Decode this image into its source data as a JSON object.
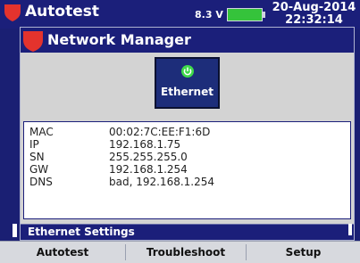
{
  "status_bar": {
    "app_title": "Autotest",
    "voltage": "8.3 V",
    "date": "20-Aug-2014",
    "time": "22:32:14",
    "battery_level_percent": 100
  },
  "window": {
    "title": "Network Manager",
    "tile": {
      "label": "Ethernet",
      "icon": "power-icon"
    },
    "info": [
      {
        "key": "MAC",
        "value": "00:02:7C:EE:F1:6D"
      },
      {
        "key": "IP",
        "value": "192.168.1.75"
      },
      {
        "key": "SN",
        "value": "255.255.255.0"
      },
      {
        "key": "GW",
        "value": "192.168.1.254"
      },
      {
        "key": "DNS",
        "value": "bad, 192.168.1.254"
      }
    ],
    "settings_label": "Ethernet Settings"
  },
  "bottom_bar": {
    "buttons": [
      "Autotest",
      "Troubleshoot",
      "Setup"
    ]
  },
  "colors": {
    "accent_red": "#e4332d",
    "bar_navy": "#1b1f7a",
    "battery_green": "#35c33b",
    "power_green": "#3fd94a"
  }
}
